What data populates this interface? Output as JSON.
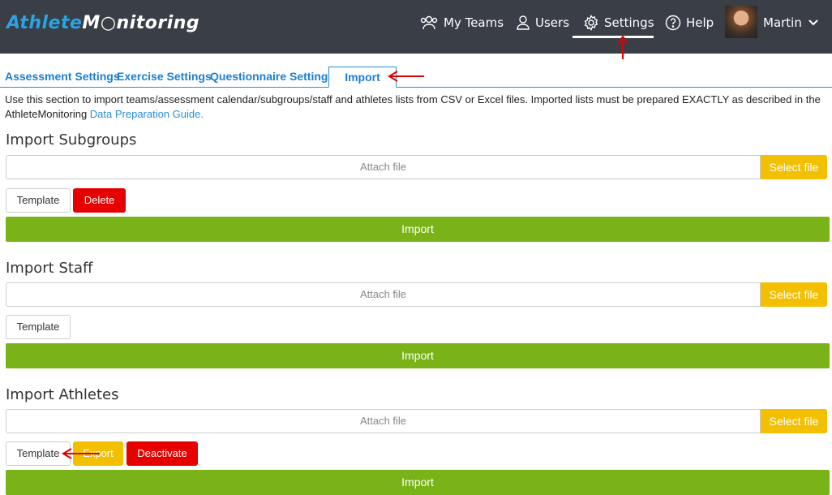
{
  "header": {
    "logo_part1": "Athlete",
    "logo_part2": "M",
    "logo_part3": "nitoring",
    "nav": {
      "my_teams": "My Teams",
      "users": "Users",
      "settings": "Settings",
      "help": "Help"
    },
    "user_name": "Martin"
  },
  "tabs": {
    "assessment": "Assessment Settings",
    "exercise": "Exercise Settings",
    "questionnaire": "Questionnaire Settings",
    "import": "Import"
  },
  "intro": {
    "text": "Use this section to import teams/assessment calendar/subgroups/staff and athletes lists from CSV or Excel files. Imported lists must be prepared EXACTLY as described in the AthleteMonitoring ",
    "link": "Data Preparation Guide."
  },
  "sections": {
    "subgroups": {
      "title": "Import Subgroups",
      "attach_placeholder": "Attach file",
      "select_file": "Select file",
      "template": "Template",
      "delete": "Delete",
      "import": "Import"
    },
    "staff": {
      "title": "Import Staff",
      "attach_placeholder": "Attach file",
      "select_file": "Select file",
      "template": "Template",
      "import": "Import"
    },
    "athletes": {
      "title": "Import Athletes",
      "attach_placeholder": "Attach file",
      "select_file": "Select file",
      "template": "Template",
      "export": "Export",
      "deactivate": "Deactivate",
      "import": "Import"
    }
  },
  "colors": {
    "header_bg": "#3a3e47",
    "logo_blue": "#2ba3e3",
    "link_blue": "#1a7fcf",
    "select_yellow": "#f2c000",
    "delete_red": "#e60000",
    "import_green": "#7ab317",
    "annotation_red": "#e00000"
  },
  "icons": {
    "my_teams": "group-icon",
    "users": "user-icon",
    "settings": "gear-icon",
    "help": "question-circle-icon",
    "user_menu": "chevron-down-icon"
  }
}
